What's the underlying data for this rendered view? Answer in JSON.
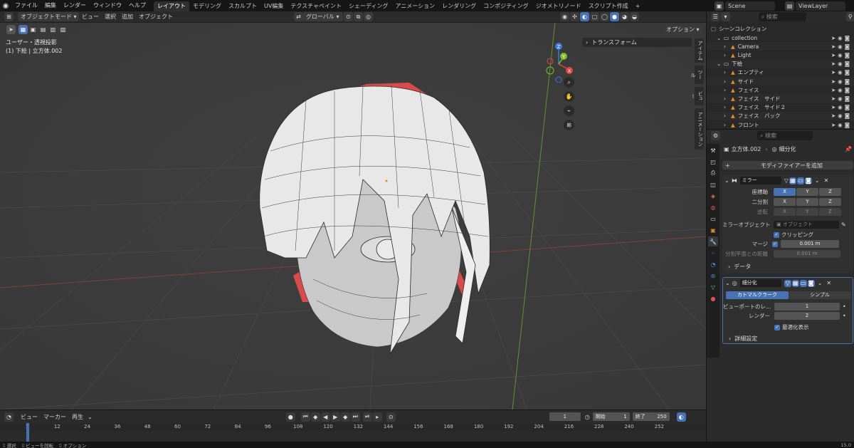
{
  "menubar": {
    "items": [
      "ファイル",
      "編集",
      "レンダー",
      "ウィンドウ",
      "ヘルプ"
    ],
    "workspaces": [
      "レイアウト",
      "モデリング",
      "スカルプト",
      "UV編集",
      "テクスチャペイント",
      "シェーディング",
      "アニメーション",
      "レンダリング",
      "コンポジティング",
      "ジオメトリノード",
      "スクリプト作成"
    ],
    "add_tab": "+",
    "scene": "Scene",
    "view_layer": "ViewLayer"
  },
  "viewport": {
    "mode": "オブジェクトモード",
    "menus": [
      "ビュー",
      "選択",
      "追加",
      "オブジェクト"
    ],
    "orientation": "グローバル",
    "options": "オプション",
    "info_view": "ユーザー・透視投影",
    "info_object": "(1) 下絵 | 立方体.002",
    "transform_panel": "トランスフォーム",
    "side_tabs": [
      "アイテム",
      "ツール",
      "ビュー",
      "アニメーション"
    ],
    "gizmo": {
      "x": "X",
      "y": "Y",
      "z": "Z"
    }
  },
  "outliner": {
    "search_placeholder": "検索",
    "root": "シーンコレクション",
    "rows": [
      {
        "label": "collection",
        "indent": 1
      },
      {
        "label": "Camera",
        "indent": 2
      },
      {
        "label": "Light",
        "indent": 2
      },
      {
        "label": "下絵",
        "indent": 1
      },
      {
        "label": "エンプティ",
        "indent": 2
      },
      {
        "label": "サイド",
        "indent": 2
      },
      {
        "label": "フェイス",
        "indent": 2
      },
      {
        "label": "フェイス　サイド",
        "indent": 2
      },
      {
        "label": "フェイス　サイド２",
        "indent": 2
      },
      {
        "label": "フェイス　バック",
        "indent": 2
      },
      {
        "label": "フロント",
        "indent": 2
      }
    ]
  },
  "properties": {
    "search_placeholder": "検索",
    "object_name": "立方体.002",
    "modifier_context": "細分化",
    "add_modifier": "モディファイアーを追加",
    "mirror": {
      "name": "ミラー",
      "axis_label": "座標軸",
      "bisect_label": "二分割",
      "flip_label": "逆転",
      "axes": [
        "X",
        "Y",
        "Z"
      ],
      "mirror_object_label": "ミラーオブジェクト",
      "mirror_object_placeholder": "オブジェクト",
      "clipping": "クリッピング",
      "merge_label": "マージ",
      "merge_value": "0.001 m",
      "bisect_distance_label": "分割平面との距離",
      "bisect_distance_value": "0.001 m",
      "data": "データ"
    },
    "subsurf": {
      "name": "細分化",
      "catmull": "カトマルクラーク",
      "simple": "シンプル",
      "viewport_label": "ビューポートのレ...",
      "viewport_value": "1",
      "render_label": "レンダー",
      "render_value": "2",
      "optimal": "最適化表示",
      "advanced": "詳細設定"
    }
  },
  "timeline": {
    "menus": [
      "ビュー",
      "マーカー",
      "再生"
    ],
    "current_frame": "1",
    "start_label": "開始",
    "start_value": "1",
    "end_label": "終了",
    "end_value": "250",
    "ticks": [
      "1",
      "12",
      "24",
      "36",
      "48",
      "60",
      "72",
      "84",
      "96",
      "108",
      "120",
      "132",
      "144",
      "156",
      "168",
      "180",
      "192",
      "204",
      "216",
      "228",
      "240",
      "252"
    ]
  },
  "statusbar": {
    "select": "選択",
    "rotate": "ビューを回転",
    "options": "オプション",
    "version": "15.0"
  },
  "colors": {
    "accent": "#4772b3",
    "x_axis": "#e34444",
    "y_axis": "#7fbf2a",
    "z_axis": "#3c78e0"
  }
}
